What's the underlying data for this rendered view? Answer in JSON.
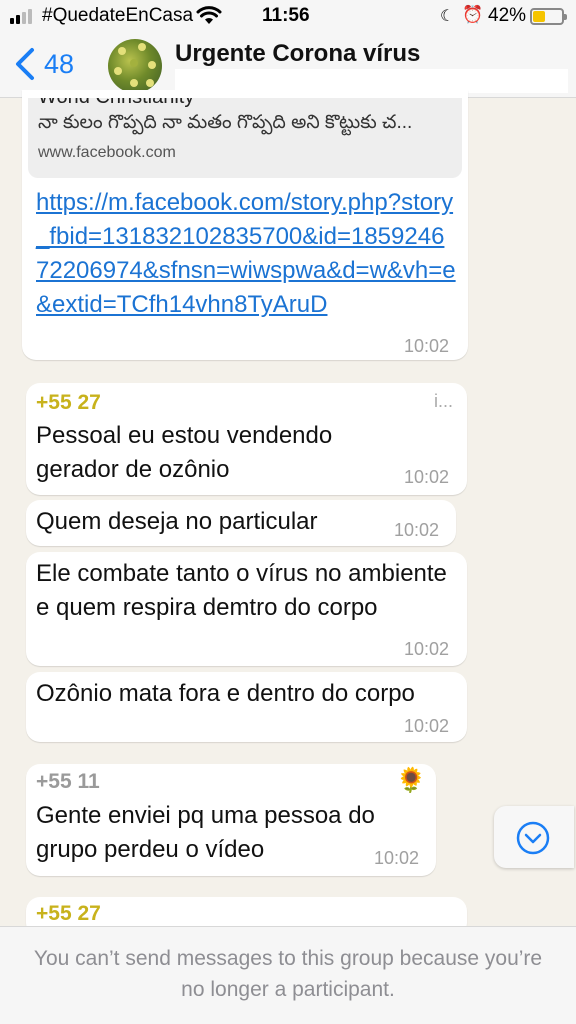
{
  "status_bar": {
    "carrier": "#QuedateEnCasa",
    "time": "11:56",
    "battery_percent": "42%",
    "battery_level": 0.42,
    "icons": [
      "signal-icon",
      "wifi-icon",
      "moon-icon",
      "alarm-icon",
      "battery-icon"
    ]
  },
  "header": {
    "back_count": "48",
    "title": "Urgente Corona vírus"
  },
  "messages": [
    {
      "preview_title": "World Christianity",
      "preview_description": "నా కులం గొప్పది నా మతం గొప్పది అని కొట్టుకు చ...",
      "preview_domain": "www.facebook.com",
      "link": "https://m.facebook.com/story.php?story_fbid=131832102835700&id=185924672206974&sfnsn=wiwspwa&d=w&vh=e&extid=TCfh14vhn8TyAruD",
      "time": "10:02"
    },
    {
      "sender": "+55 27",
      "sender_suffix": "i...",
      "text": "Pessoal eu estou vendendo gerador de ozônio",
      "time": "10:02"
    },
    {
      "text": "Quem deseja no particular",
      "time": "10:02"
    },
    {
      "text": "Ele combate tanto o vírus no ambiente e quem respira demtro do corpo",
      "time": "10:02"
    },
    {
      "text": "Ozônio mata fora e dentro do corpo",
      "time": "10:02"
    },
    {
      "sender": "+55 11",
      "sender_emoji": "🌻",
      "text": "Gente enviei  pq uma pessoa do grupo perdeu o vídeo",
      "time": "10:02"
    },
    {
      "sender": "+55 27"
    }
  ],
  "footer": {
    "notice": "You can’t send messages to this group because you’re no longer a participant."
  },
  "colors": {
    "accent": "#1a7ef5",
    "link": "#1b73d3",
    "sender_yellow": "#c8b21c",
    "sender_gray": "#9a9a9a",
    "chat_bg": "#f4f1ea"
  }
}
